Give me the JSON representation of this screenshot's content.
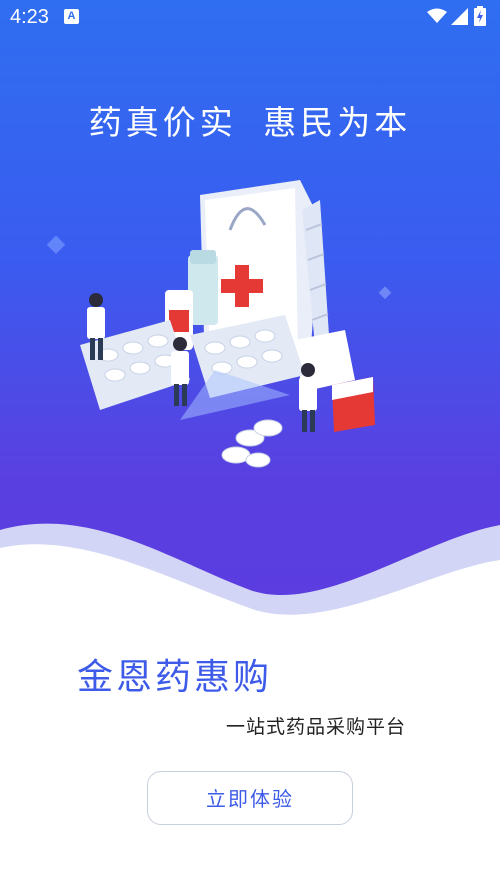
{
  "status_bar": {
    "time": "4:23",
    "notification_icon": "text-a-icon",
    "wifi_icon": "wifi-icon",
    "signal_icon": "signal-icon",
    "battery_icon": "battery-charging-icon"
  },
  "hero": {
    "slogan": "药真价实  惠民为本",
    "illustration": "pharmacy-illustration"
  },
  "brand": {
    "name": "金恩药惠购",
    "tagline": "一站式药品采购平台"
  },
  "cta": {
    "label": "立即体验"
  },
  "colors": {
    "gradient_top": "#2f6ef0",
    "gradient_bottom": "#5b3ce0",
    "brand_blue": "#3d5be8"
  }
}
